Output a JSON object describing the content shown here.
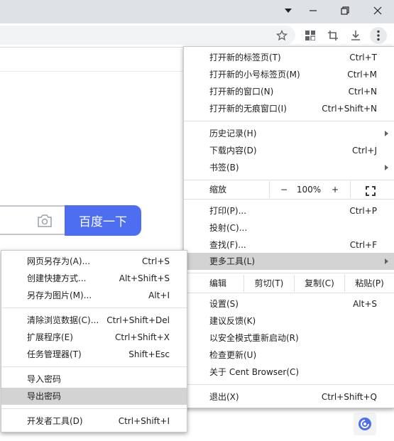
{
  "window": {
    "icons": [
      "tab-search-icon",
      "minimize-icon",
      "restore-icon",
      "close-icon"
    ]
  },
  "toolbar": {
    "icons": [
      "star-icon",
      "extensions-grid-icon",
      "crop-icon",
      "download-icon",
      "kebab-menu-icon"
    ]
  },
  "page": {
    "search_button_label": "百度一下"
  },
  "main_menu": {
    "new_tab": {
      "label": "打开新的标签页(T)",
      "shortcut": "Ctrl+T"
    },
    "new_small_tab": {
      "label": "打开新的小号标签页(M)",
      "shortcut": "Ctrl+M"
    },
    "new_window": {
      "label": "打开新的窗口(N)",
      "shortcut": "Ctrl+N"
    },
    "new_incognito": {
      "label": "打开新的无痕窗口(I)",
      "shortcut": "Ctrl+Shift+N"
    },
    "history": {
      "label": "历史记录(H)"
    },
    "downloads": {
      "label": "下载内容(D)",
      "shortcut": "Ctrl+J"
    },
    "bookmarks": {
      "label": "书签(B)"
    },
    "zoom": {
      "label": "缩放",
      "minus": "−",
      "value": "100%",
      "plus": "+"
    },
    "print": {
      "label": "打印(P)...",
      "shortcut": "Ctrl+P"
    },
    "cast": {
      "label": "投射(C)..."
    },
    "find": {
      "label": "查找(F)...",
      "shortcut": "Ctrl+F"
    },
    "more_tools": {
      "label": "更多工具(L)"
    },
    "edit": {
      "label": "编辑",
      "cut": "剪切(T)",
      "copy": "复制(C)",
      "paste": "粘贴(P)"
    },
    "settings": {
      "label": "设置(S)",
      "shortcut": "Alt+S"
    },
    "feedback": {
      "label": "建议反馈(K)"
    },
    "safe_mode": {
      "label": "以安全模式重新启动(R)"
    },
    "check_update": {
      "label": "检查更新(U)"
    },
    "about": {
      "label": "关于 Cent Browser(C)"
    },
    "exit": {
      "label": "退出(X)",
      "shortcut": "Ctrl+Shift+Q"
    }
  },
  "submenu": {
    "save_page": {
      "label": "网页另存为(A)...",
      "shortcut": "Ctrl+S"
    },
    "create_shortcut": {
      "label": "创建快捷方式...",
      "shortcut": "Alt+Shift+S"
    },
    "save_as_image": {
      "label": "另存为图片(M)...",
      "shortcut": "Alt+I"
    },
    "clear_data": {
      "label": "清除浏览数据(C)...",
      "shortcut": "Ctrl+Shift+Del"
    },
    "extensions": {
      "label": "扩展程序(E)",
      "shortcut": "Ctrl+Shift+X"
    },
    "task_manager": {
      "label": "任务管理器(T)",
      "shortcut": "Shift+Esc"
    },
    "import_passwords": {
      "label": "导入密码"
    },
    "export_passwords": {
      "label": "导出密码"
    },
    "dev_tools": {
      "label": "开发者工具(D)",
      "shortcut": "Ctrl+Shift+I"
    }
  }
}
